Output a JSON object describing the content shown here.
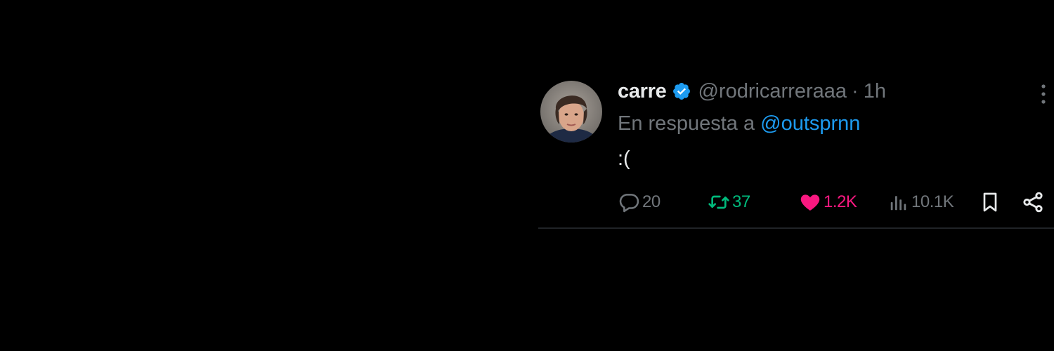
{
  "tweet": {
    "author": {
      "name": "carre",
      "handle": "@rodricarreraaa",
      "verified": true,
      "avatar": "profile-photo"
    },
    "separator": "·",
    "time": "1h",
    "reply_prefix": "En respuesta a",
    "reply_to": "@outsprnn",
    "text": ":(",
    "actions": {
      "replies": "20",
      "retweets": "37",
      "likes": "1.2K",
      "views": "10.1K"
    }
  },
  "icons": {
    "verified": "verified-badge-icon",
    "more": "more-options-icon",
    "reply": "reply-bubble-icon",
    "retweet": "retweet-icon",
    "like": "heart-icon",
    "views": "views-chart-icon",
    "bookmark": "bookmark-icon",
    "share": "share-icon"
  },
  "colors": {
    "background": "#000000",
    "text": "#e7e9ea",
    "muted": "#71767b",
    "link": "#1d9bf0",
    "retweet": "#00ba7c",
    "like": "#f91880"
  }
}
